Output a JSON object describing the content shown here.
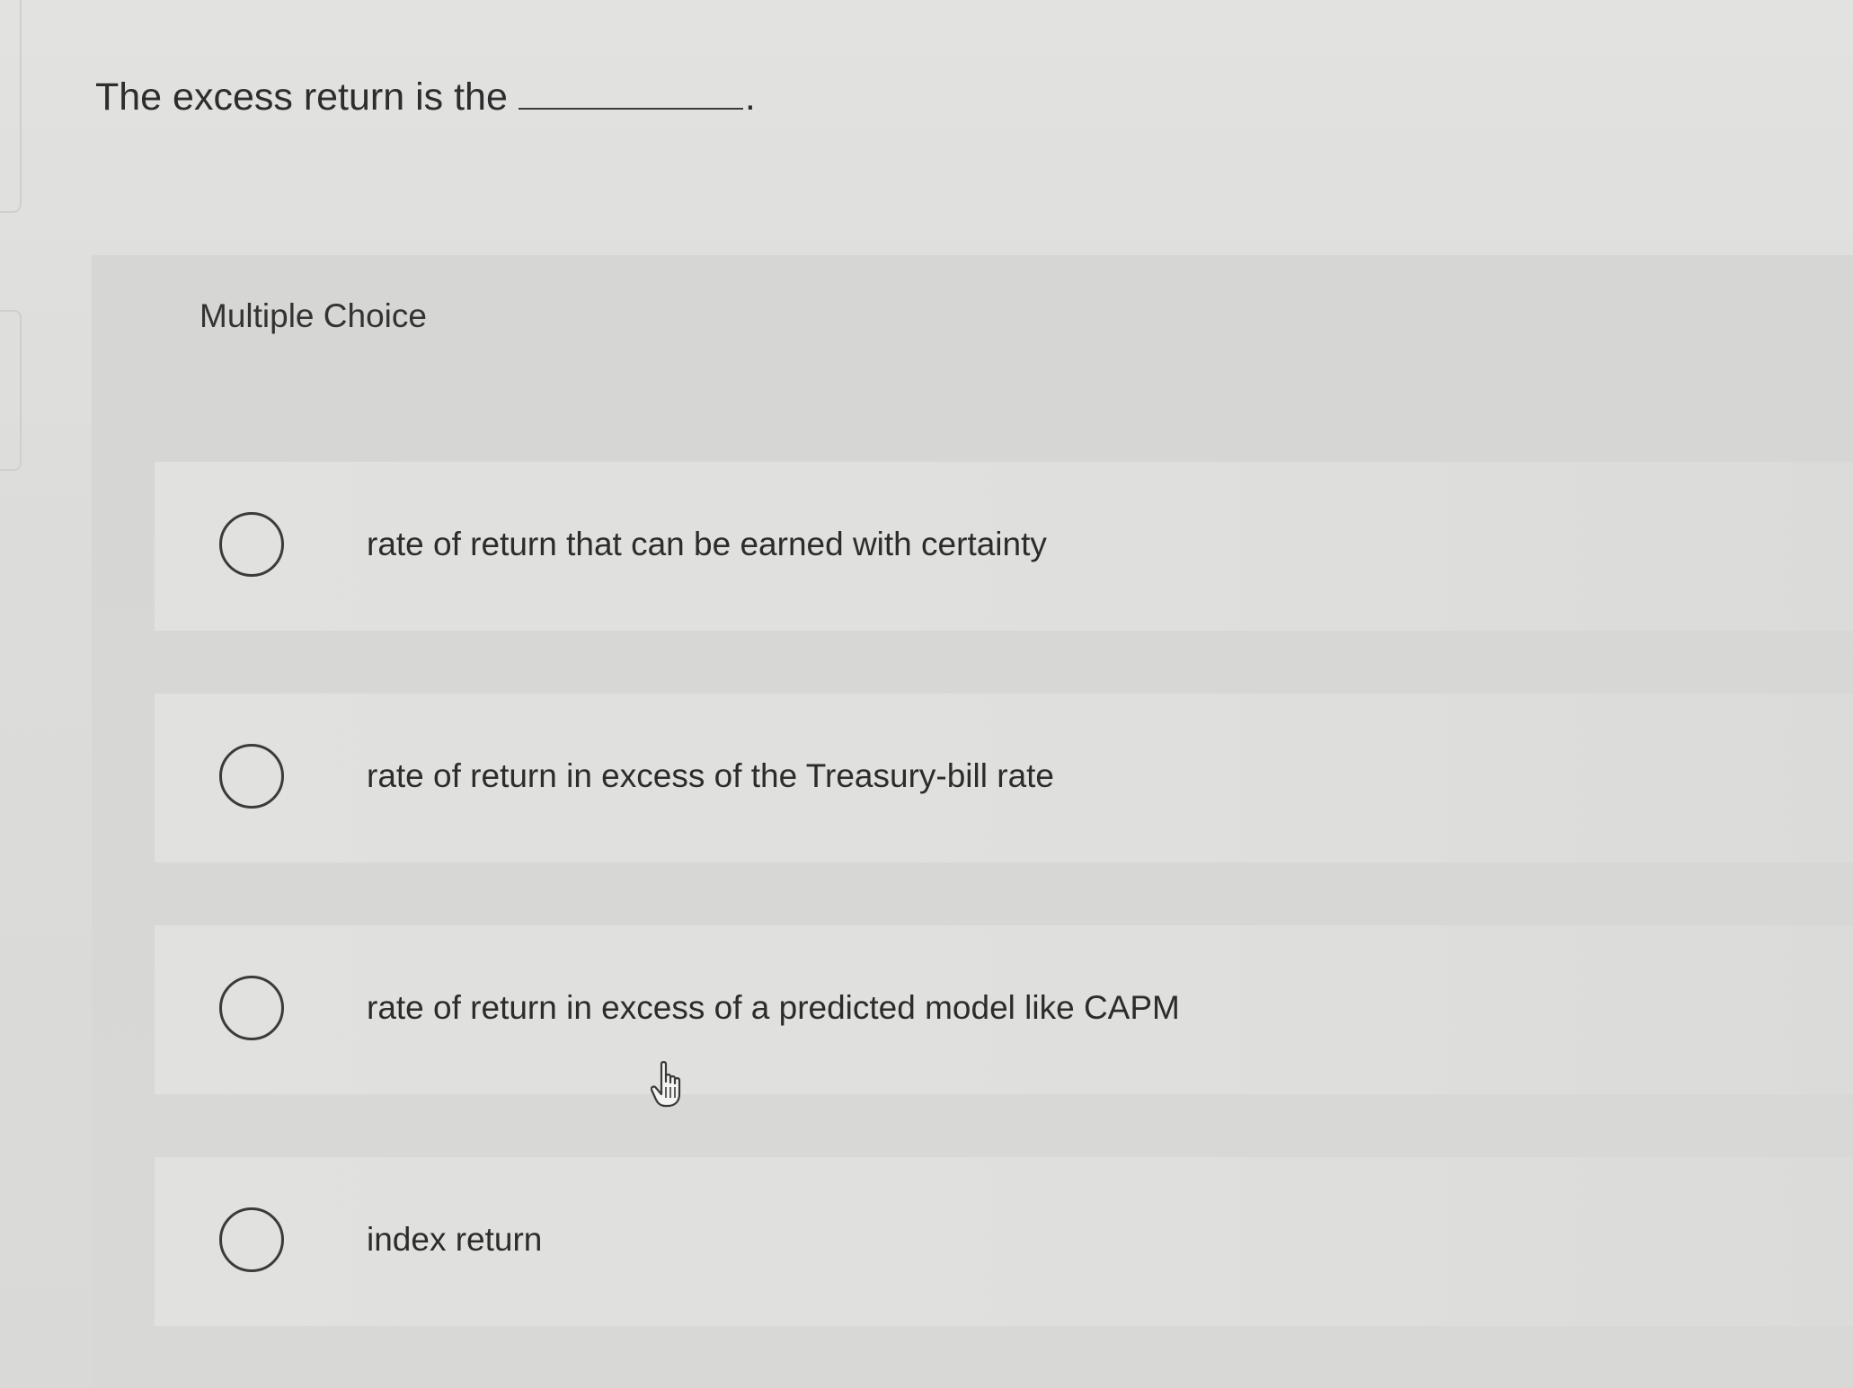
{
  "question": {
    "text": "The excess return is the",
    "period": "."
  },
  "multiple_choice": {
    "header": "Multiple Choice",
    "options": [
      {
        "label": "rate of return that can be earned with certainty",
        "selected": false
      },
      {
        "label": "rate of return in excess of the Treasury-bill rate",
        "selected": false
      },
      {
        "label": "rate of return in excess of a predicted model like CAPM",
        "selected": false
      },
      {
        "label": "index return",
        "selected": false
      }
    ]
  },
  "icons": {
    "radio": "radio-button-unselected-icon",
    "cursor": "hand-pointer-icon"
  },
  "colors": {
    "background": "#dcdcda",
    "panel": "#d6d6d4",
    "option_row": "#e0e0de",
    "text": "#2d2d2d"
  }
}
